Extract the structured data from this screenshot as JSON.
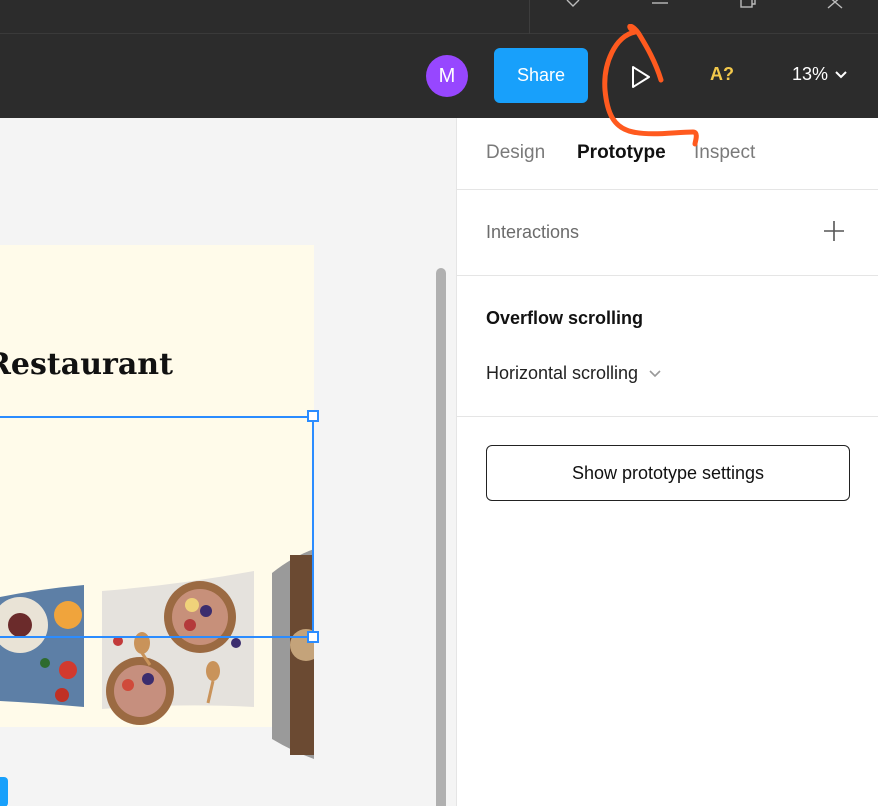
{
  "toolbar": {
    "avatar_initial": "M",
    "share_label": "Share",
    "accessibility_label": "A?",
    "zoom_label": "13%"
  },
  "canvas": {
    "frame_title": "Restaurant"
  },
  "panel": {
    "tabs": [
      {
        "label": "Design"
      },
      {
        "label": "Prototype"
      },
      {
        "label": "Inspect"
      }
    ],
    "interactions_label": "Interactions",
    "overflow_title": "Overflow scrolling",
    "overflow_value": "Horizontal scrolling",
    "prototype_settings_label": "Show prototype settings"
  },
  "colors": {
    "accent": "#18a0fb",
    "avatar": "#9747ff",
    "accessibility": "#f2c84b",
    "annotation": "#ff5a1f",
    "selection": "#2b8cff"
  },
  "icons": [
    "heart-icon",
    "minimize-icon",
    "restore-icon",
    "close-icon",
    "play-icon",
    "chevron-down-icon",
    "plus-icon"
  ]
}
